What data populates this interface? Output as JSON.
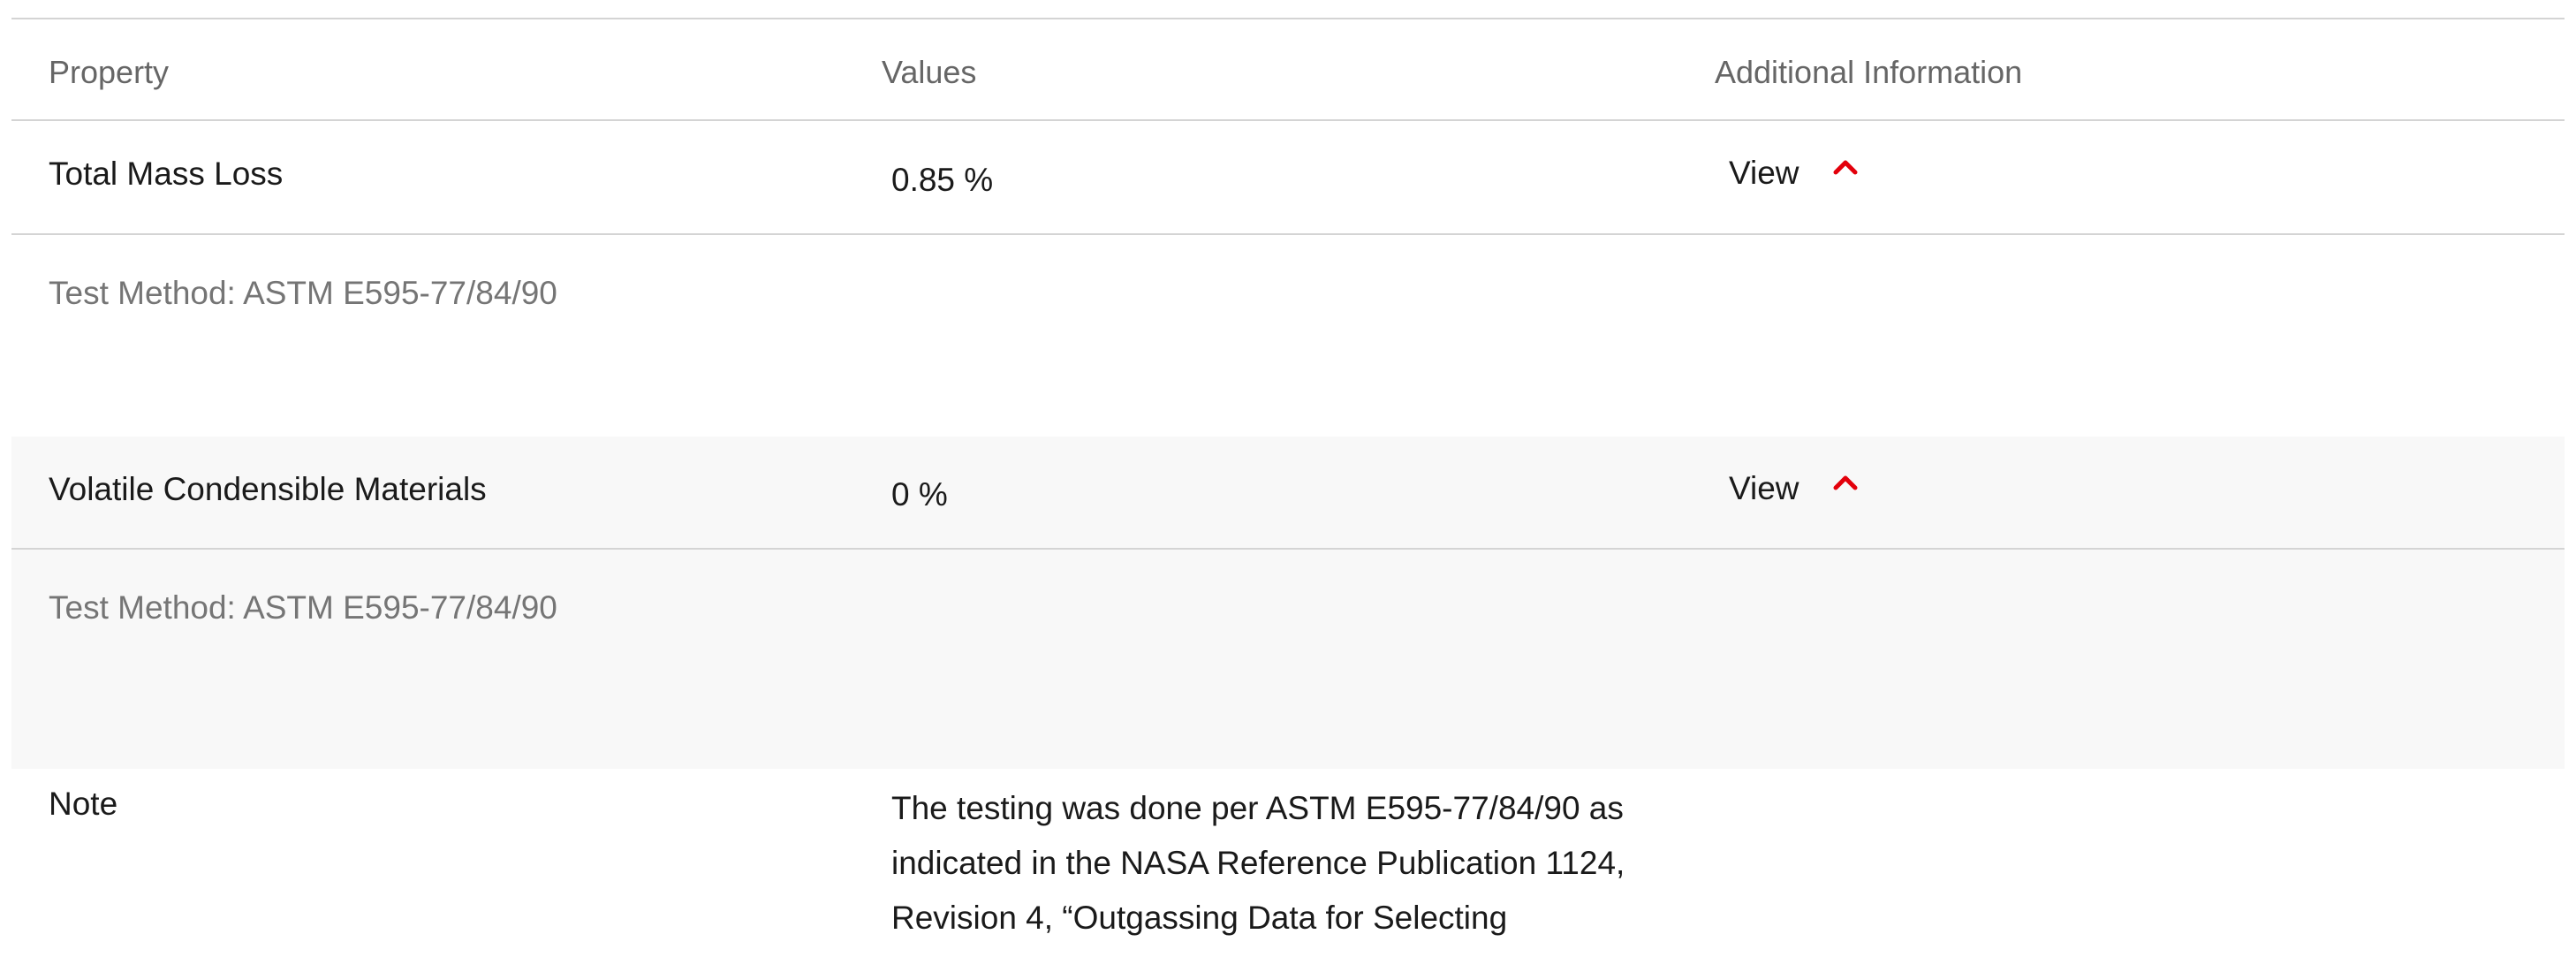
{
  "table": {
    "headers": {
      "property": "Property",
      "values": "Values",
      "additional": "Additional Information"
    },
    "rows": [
      {
        "property": "Total Mass Loss",
        "value": "0.85 %",
        "link_label": "View",
        "test_method": "Test Method: ASTM E595-77/84/90"
      },
      {
        "property": "Volatile Condensible Materials",
        "value": "0 %",
        "link_label": "View",
        "test_method": "Test Method: ASTM E595-77/84/90"
      }
    ],
    "note": {
      "label": "Note",
      "text": "The testing was done per ASTM E595-77/84/90 as indicated in the NASA Reference Publication 1124, Revision 4, “Outgassing Data for Selecting"
    }
  },
  "colors": {
    "accent_chevron": "#e3000b",
    "row_shade": "#f8f8f8",
    "divider": "#d4d4d4"
  },
  "icons": {
    "expand_toggle": "chevron-up-icon"
  }
}
